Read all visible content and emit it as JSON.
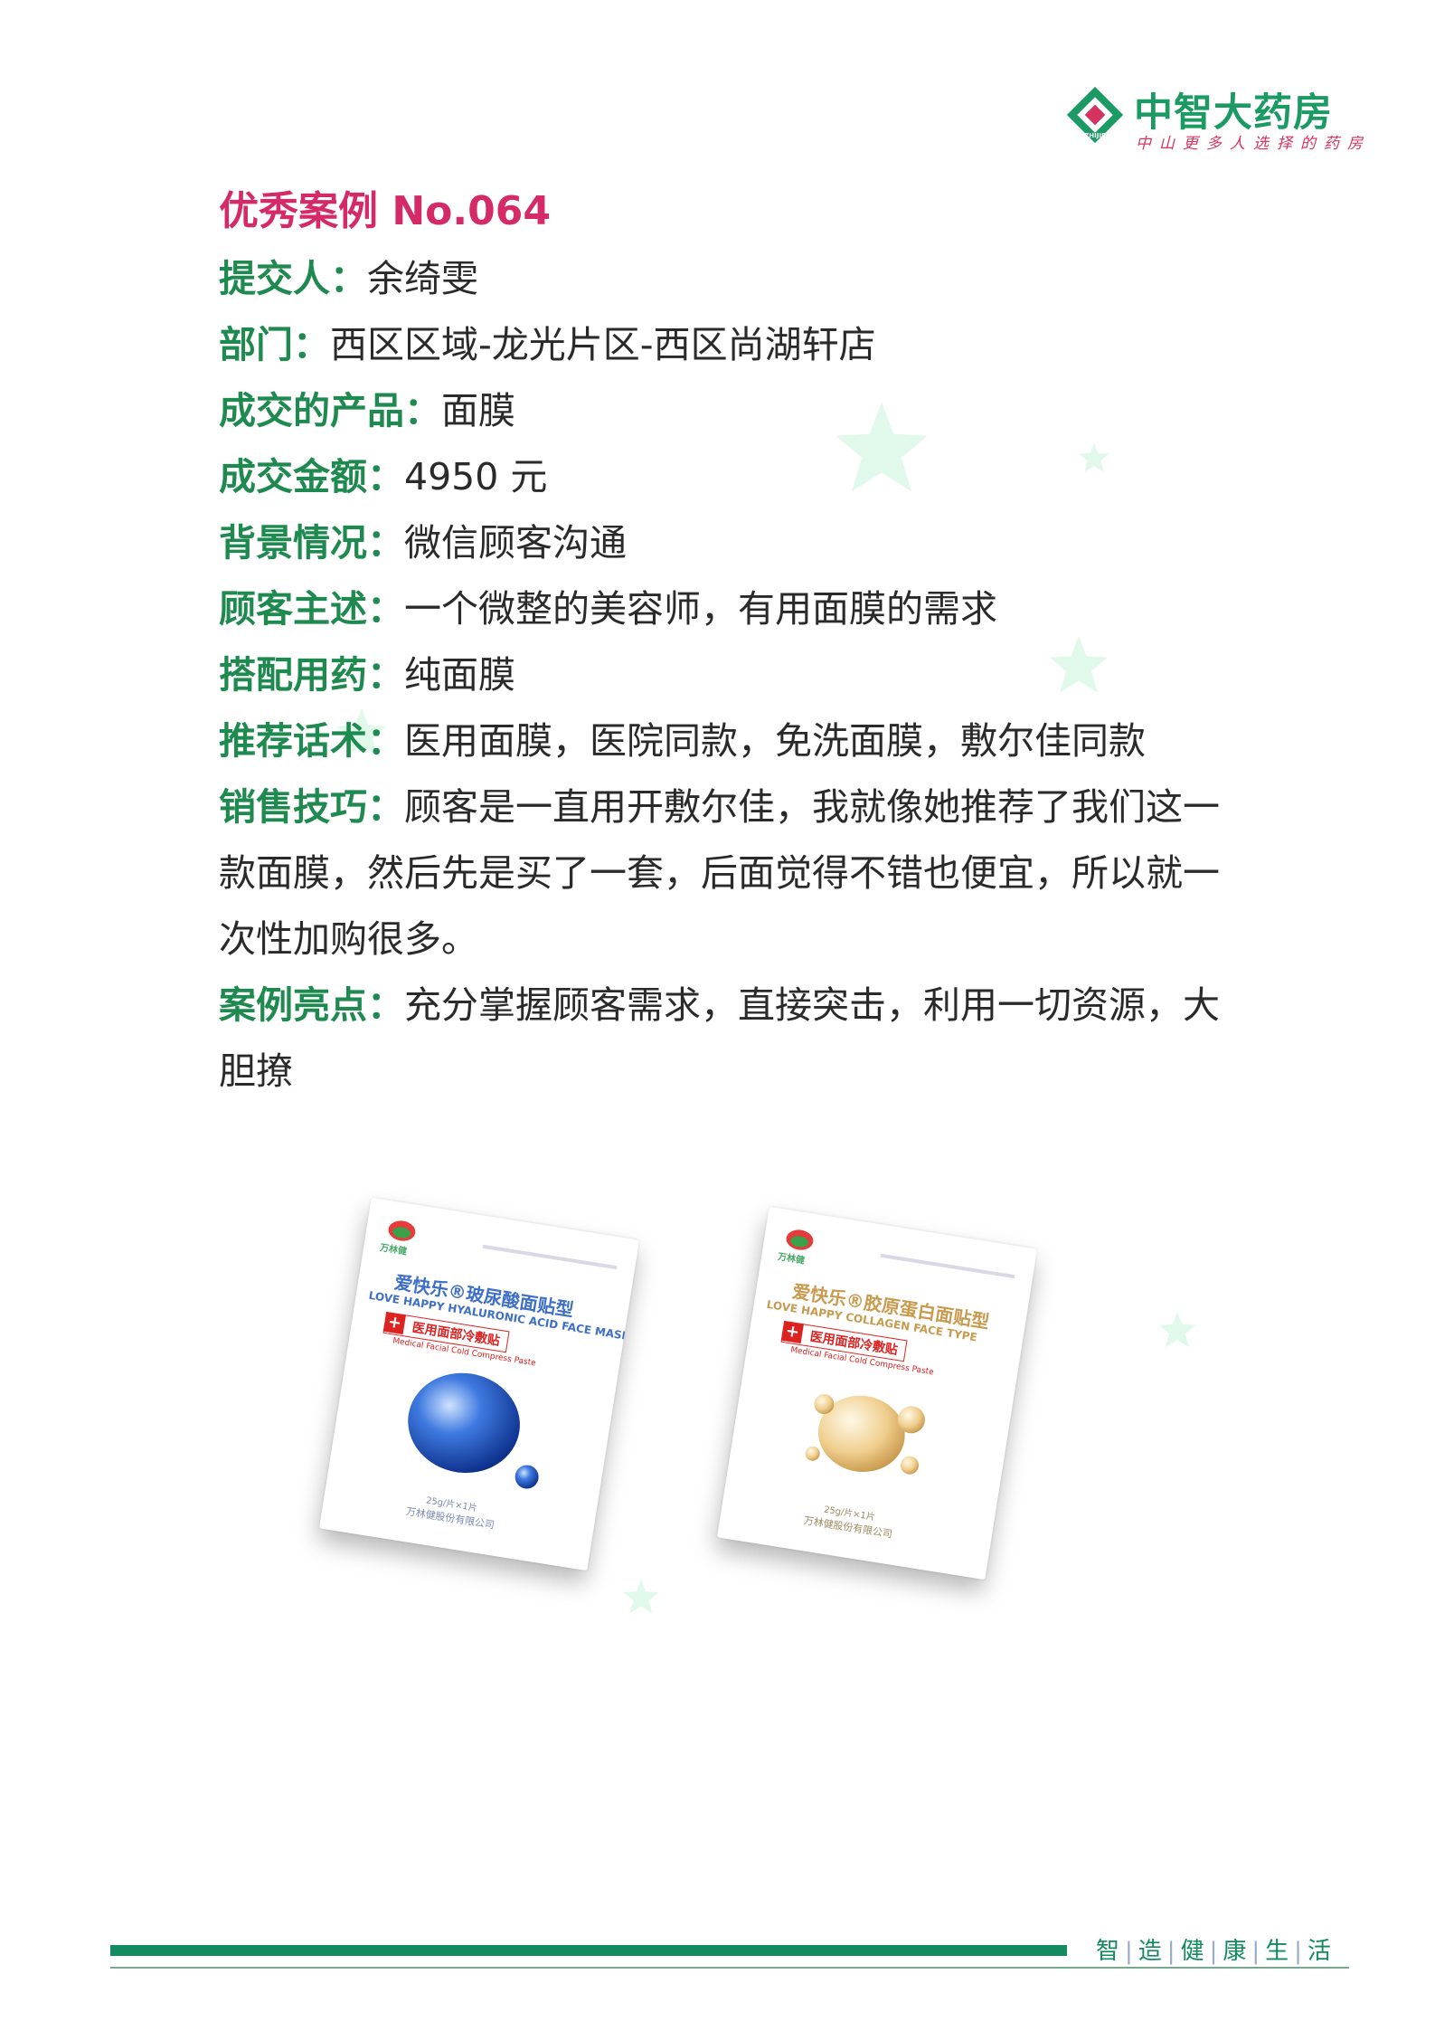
{
  "brand": {
    "name": "中智大药房",
    "slogan": "中山更多人选择的药房",
    "logo_mark_text": "ZHIJIE",
    "colors": {
      "green": "#1b9a63",
      "red": "#d4335f"
    }
  },
  "case": {
    "title": "优秀案例 No.064",
    "fields": [
      {
        "label": "提交人：",
        "value": "余绮雯"
      },
      {
        "label": "部门：",
        "value": "西区区域-龙光片区-西区尚湖轩店"
      },
      {
        "label": "成交的产品：",
        "value": "面膜"
      },
      {
        "label": "成交金额：",
        "value": "4950 元"
      },
      {
        "label": "背景情况：",
        "value": "微信顾客沟通"
      },
      {
        "label": "顾客主述：",
        "value": "一个微整的美容师，有用面膜的需求"
      },
      {
        "label": "搭配用药：",
        "value": "纯面膜"
      },
      {
        "label": "推荐话术：",
        "value": "医用面膜，医院同款，免洗面膜，敷尔佳同款"
      },
      {
        "label": "销售技巧：",
        "value": "顾客是一直用开敷尔佳，我就像她推荐了我们这一款面膜，然后先是买了一套，后面觉得不错也便宜，所以就一次性加购很多。"
      },
      {
        "label": "案例亮点：",
        "value": "充分掌握顾客需求，直接突击，利用一切资源，大胆撩"
      }
    ]
  },
  "products": [
    {
      "brand": "万林健",
      "name": "爱快乐®玻尿酸面贴型",
      "name_en": "LOVE HAPPY HYALURONIC ACID FACE MASK",
      "type": "医用面部冷敷贴",
      "type_en": "Medical Facial Cold Compress Paste",
      "weight": "25g/片×1片",
      "company": "万林健股份有限公司",
      "color": "#3d6fc9"
    },
    {
      "brand": "万林健",
      "name": "爱快乐®胶原蛋白面贴型",
      "name_en": "LOVE HAPPY COLLAGEN FACE TYPE",
      "type": "医用面部冷敷贴",
      "type_en": "Medical Facial Cold Compress Paste",
      "weight": "25g/片×1片",
      "company": "万林健股份有限公司",
      "color": "#c99a4d"
    }
  ],
  "footer": {
    "words": [
      "智",
      "造",
      "健",
      "康",
      "生",
      "活"
    ],
    "color": "#138a5f"
  }
}
